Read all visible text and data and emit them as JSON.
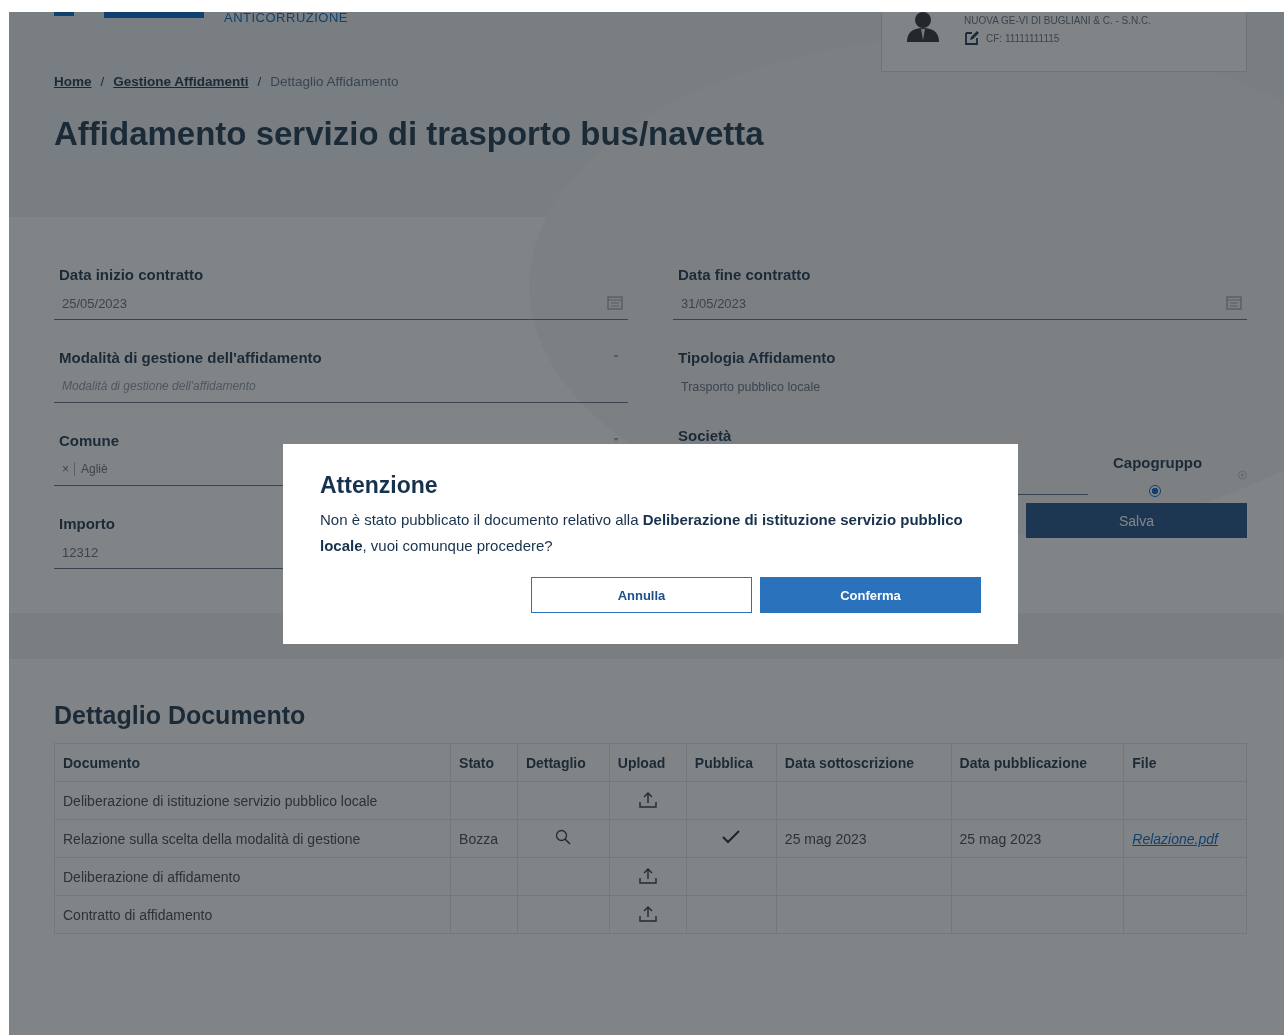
{
  "header": {
    "logo_subtitle": "ANTICORRUZIONE",
    "user": {
      "company": "NUOVA GE-VI DI BUGLIANI & C. - S.N.C.",
      "tax_code": "CF: 11111111115"
    }
  },
  "breadcrumb_separator": "/",
  "breadcrumb": [
    {
      "label": "Home",
      "link": true
    },
    {
      "label": "Gestione Affidamenti",
      "link": true
    },
    {
      "label": "Dettaglio Affidamento",
      "link": false
    }
  ],
  "title": "Affidamento servizio di trasporto bus/navetta",
  "form": {
    "data_inizio": {
      "label": "Data inizio contratto",
      "value": "25/05/2023"
    },
    "data_fine": {
      "label": "Data fine contratto",
      "value": "31/05/2023"
    },
    "modalita": {
      "label": "Modalità di gestione dell'affidamento",
      "placeholder": "Modalità di gestione dell'affidamento"
    },
    "tipologia": {
      "label": "Tipologia Affidamento",
      "value": "Trasporto pubblico locale"
    },
    "comune": {
      "label": "Comune",
      "chips": [
        {
          "remove": "×",
          "label": "Agliè"
        }
      ]
    },
    "societa": {
      "label": "Società",
      "capogruppo_label": "Capogruppo",
      "capogruppo_selected": true
    },
    "importo": {
      "label": "Importo",
      "value": "12312"
    },
    "save_button": "Salva"
  },
  "documents": {
    "title": "Dettaglio Documento",
    "columns": [
      "Documento",
      "Stato",
      "Dettaglio",
      "Upload",
      "Pubblica",
      "Data sottoscrizione",
      "Data pubblicazione",
      "File"
    ],
    "rows": [
      {
        "documento": "Deliberazione di istituzione servizio pubblico locale",
        "stato": "",
        "detail": false,
        "upload": true,
        "pubblica": false,
        "data_sottoscrizione": "",
        "data_pubblicazione": "",
        "file": ""
      },
      {
        "documento": "Relazione sulla scelta della modalità di gestione",
        "stato": "Bozza",
        "detail": true,
        "upload": false,
        "pubblica": true,
        "data_sottoscrizione": "25 mag 2023",
        "data_pubblicazione": "25 mag 2023",
        "file": "Relazione.pdf"
      },
      {
        "documento": "Deliberazione di affidamento",
        "stato": "",
        "detail": false,
        "upload": true,
        "pubblica": false,
        "data_sottoscrizione": "",
        "data_pubblicazione": "",
        "file": ""
      },
      {
        "documento": "Contratto di affidamento",
        "stato": "",
        "detail": false,
        "upload": true,
        "pubblica": false,
        "data_sottoscrizione": "",
        "data_pubblicazione": "",
        "file": ""
      }
    ]
  },
  "dialog": {
    "title": "Attenzione",
    "message": "Non è stato pubblicato il documento relativo alla **Deliberazione di istituzione servizio pubblico locale**, vuoi comunque procedere?",
    "cancel": "Annulla",
    "confirm": "Conferma"
  }
}
